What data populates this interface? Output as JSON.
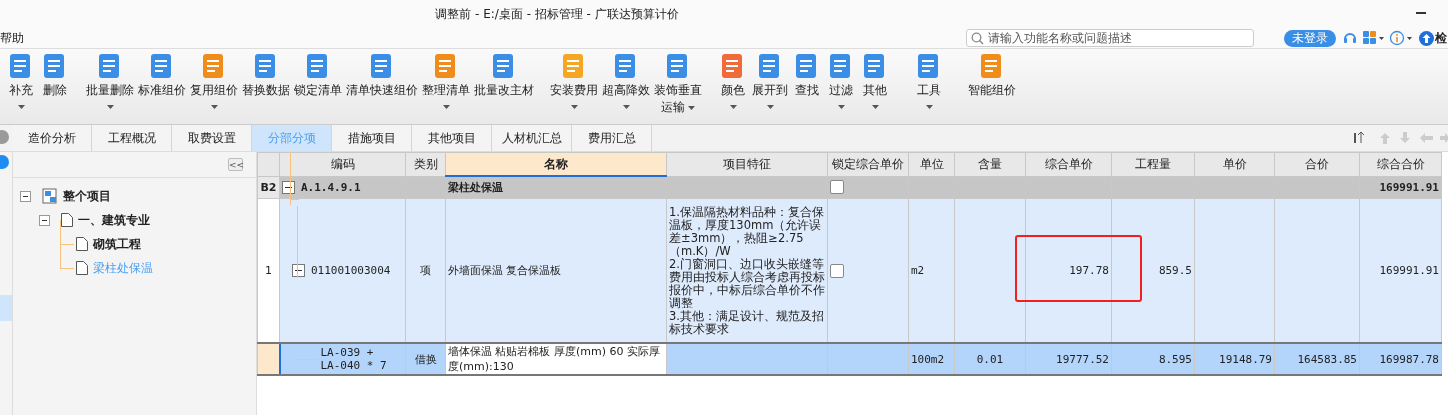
{
  "window": {
    "title": "调整前 - E:/桌面 - 招标管理 - 广联达预算计价",
    "partial_button": "检"
  },
  "menu": {
    "items": [
      "帮助"
    ]
  },
  "search": {
    "placeholder": "请输入功能名称或问题描述"
  },
  "login_button": "未登录",
  "toolbar": [
    {
      "label": "补充",
      "dropdown": true
    },
    {
      "label": "删除",
      "dropdown": false
    },
    {
      "label": "批量删除",
      "dropdown": true
    },
    {
      "label": "标准组价",
      "dropdown": false
    },
    {
      "label": "复用组价",
      "dropdown": true
    },
    {
      "label": "替换数据",
      "dropdown": false
    },
    {
      "label": "锁定清单",
      "dropdown": false
    },
    {
      "label": "清单快速组价",
      "dropdown": false
    },
    {
      "label": "整理清单",
      "dropdown": true
    },
    {
      "label": "批量改主材",
      "dropdown": false
    },
    {
      "label": "安装费用",
      "dropdown": true
    },
    {
      "label": "超高降效",
      "dropdown": true
    },
    {
      "label": "装饰垂直运输",
      "dropdown": true
    },
    {
      "label": "颜色",
      "dropdown": true
    },
    {
      "label": "展开到",
      "dropdown": true
    },
    {
      "label": "查找",
      "dropdown": false
    },
    {
      "label": "过滤",
      "dropdown": true
    },
    {
      "label": "其他",
      "dropdown": true
    },
    {
      "label": "工具",
      "dropdown": true
    },
    {
      "label": "智能组价",
      "dropdown": false
    }
  ],
  "tabs": [
    {
      "label": "造价分析",
      "selected": false
    },
    {
      "label": "工程概况",
      "selected": false
    },
    {
      "label": "取费设置",
      "selected": false
    },
    {
      "label": "分部分项",
      "selected": true
    },
    {
      "label": "措施项目",
      "selected": false
    },
    {
      "label": "其他项目",
      "selected": false
    },
    {
      "label": "人材机汇总",
      "selected": false
    },
    {
      "label": "费用汇总",
      "selected": false
    }
  ],
  "sidebar": {
    "collapse_button": "<<",
    "tree": [
      {
        "label": "整个项目",
        "selected": false,
        "expanded": true,
        "children": [
          {
            "label": "一、建筑专业",
            "selected": false,
            "expanded": true,
            "children": [
              {
                "label": "砌筑工程",
                "selected": false
              },
              {
                "label": "梁柱处保温",
                "selected": true
              }
            ]
          }
        ]
      }
    ]
  },
  "table": {
    "columns": [
      "编码",
      "类别",
      "名称",
      "项目特征",
      "锁定综合单价",
      "单位",
      "含量",
      "综合单价",
      "工程量",
      "单价",
      "合价",
      "综合合价"
    ],
    "rows": [
      {
        "kind": "section",
        "index": "B2",
        "code": "A.1.4.9.1",
        "type": "",
        "name": "梁柱处保温",
        "features": "",
        "locked": false,
        "unit": "",
        "content": "",
        "unit_rate": "",
        "quantity": "",
        "unit_price": "",
        "total": "",
        "total_rate": "169991.91",
        "selected": false
      },
      {
        "kind": "item",
        "index": "1",
        "code": "011001003004",
        "type": "项",
        "name": "外墙面保温 复合保温板",
        "features": "1.保温隔热材料品种：复合保温板，厚度130mm（允许误差±3mm），热阻≥2.75（m.K）/W\n2.门窗洞口、边口收头嵌缝等费用由投标人综合考虑再投标报价中，中标后综合单价不作调整\n3.其他：满足设计、规范及招标技术要求",
        "locked": false,
        "unit": "m2",
        "content": "",
        "unit_rate": "197.78",
        "quantity": "859.5",
        "unit_price": "",
        "total": "",
        "total_rate": "169991.91",
        "selected": false
      },
      {
        "kind": "sub",
        "index": "",
        "code": "LA-039 + LA-040 * 7",
        "type": "借换",
        "name": "墙体保温 粘贴岩棉板 厚度(mm) 60  实际厚度(mm):130",
        "unit": "100m2",
        "content": "0.01",
        "unit_rate": "19777.52",
        "quantity": "8.595",
        "unit_price": "19148.79",
        "total": "164583.85",
        "total_rate": "169987.78",
        "selected": true
      }
    ]
  }
}
